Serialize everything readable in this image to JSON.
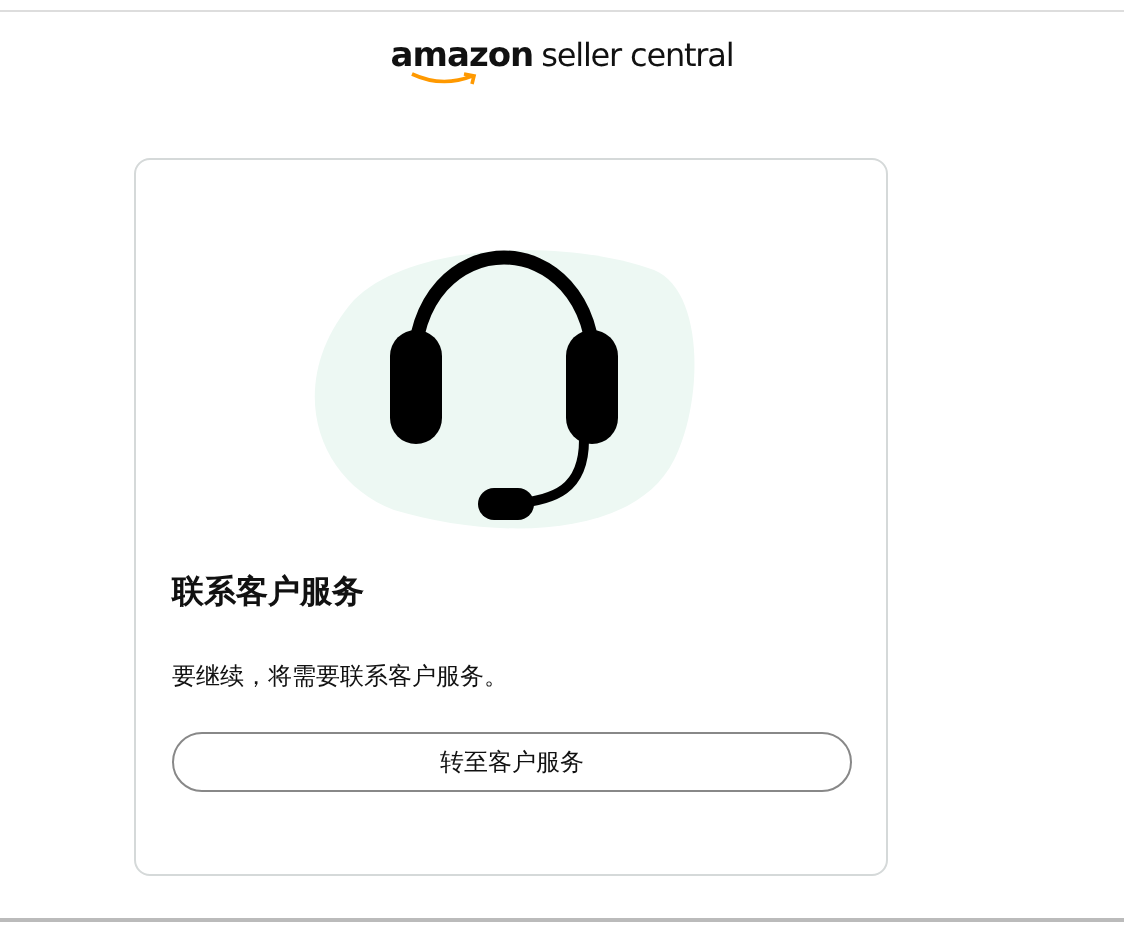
{
  "header": {
    "brand": "amazon",
    "product": "seller central"
  },
  "card": {
    "title": "联系客户服务",
    "message": "要继续，将需要联系客户服务。",
    "button": "转至客户服务"
  }
}
